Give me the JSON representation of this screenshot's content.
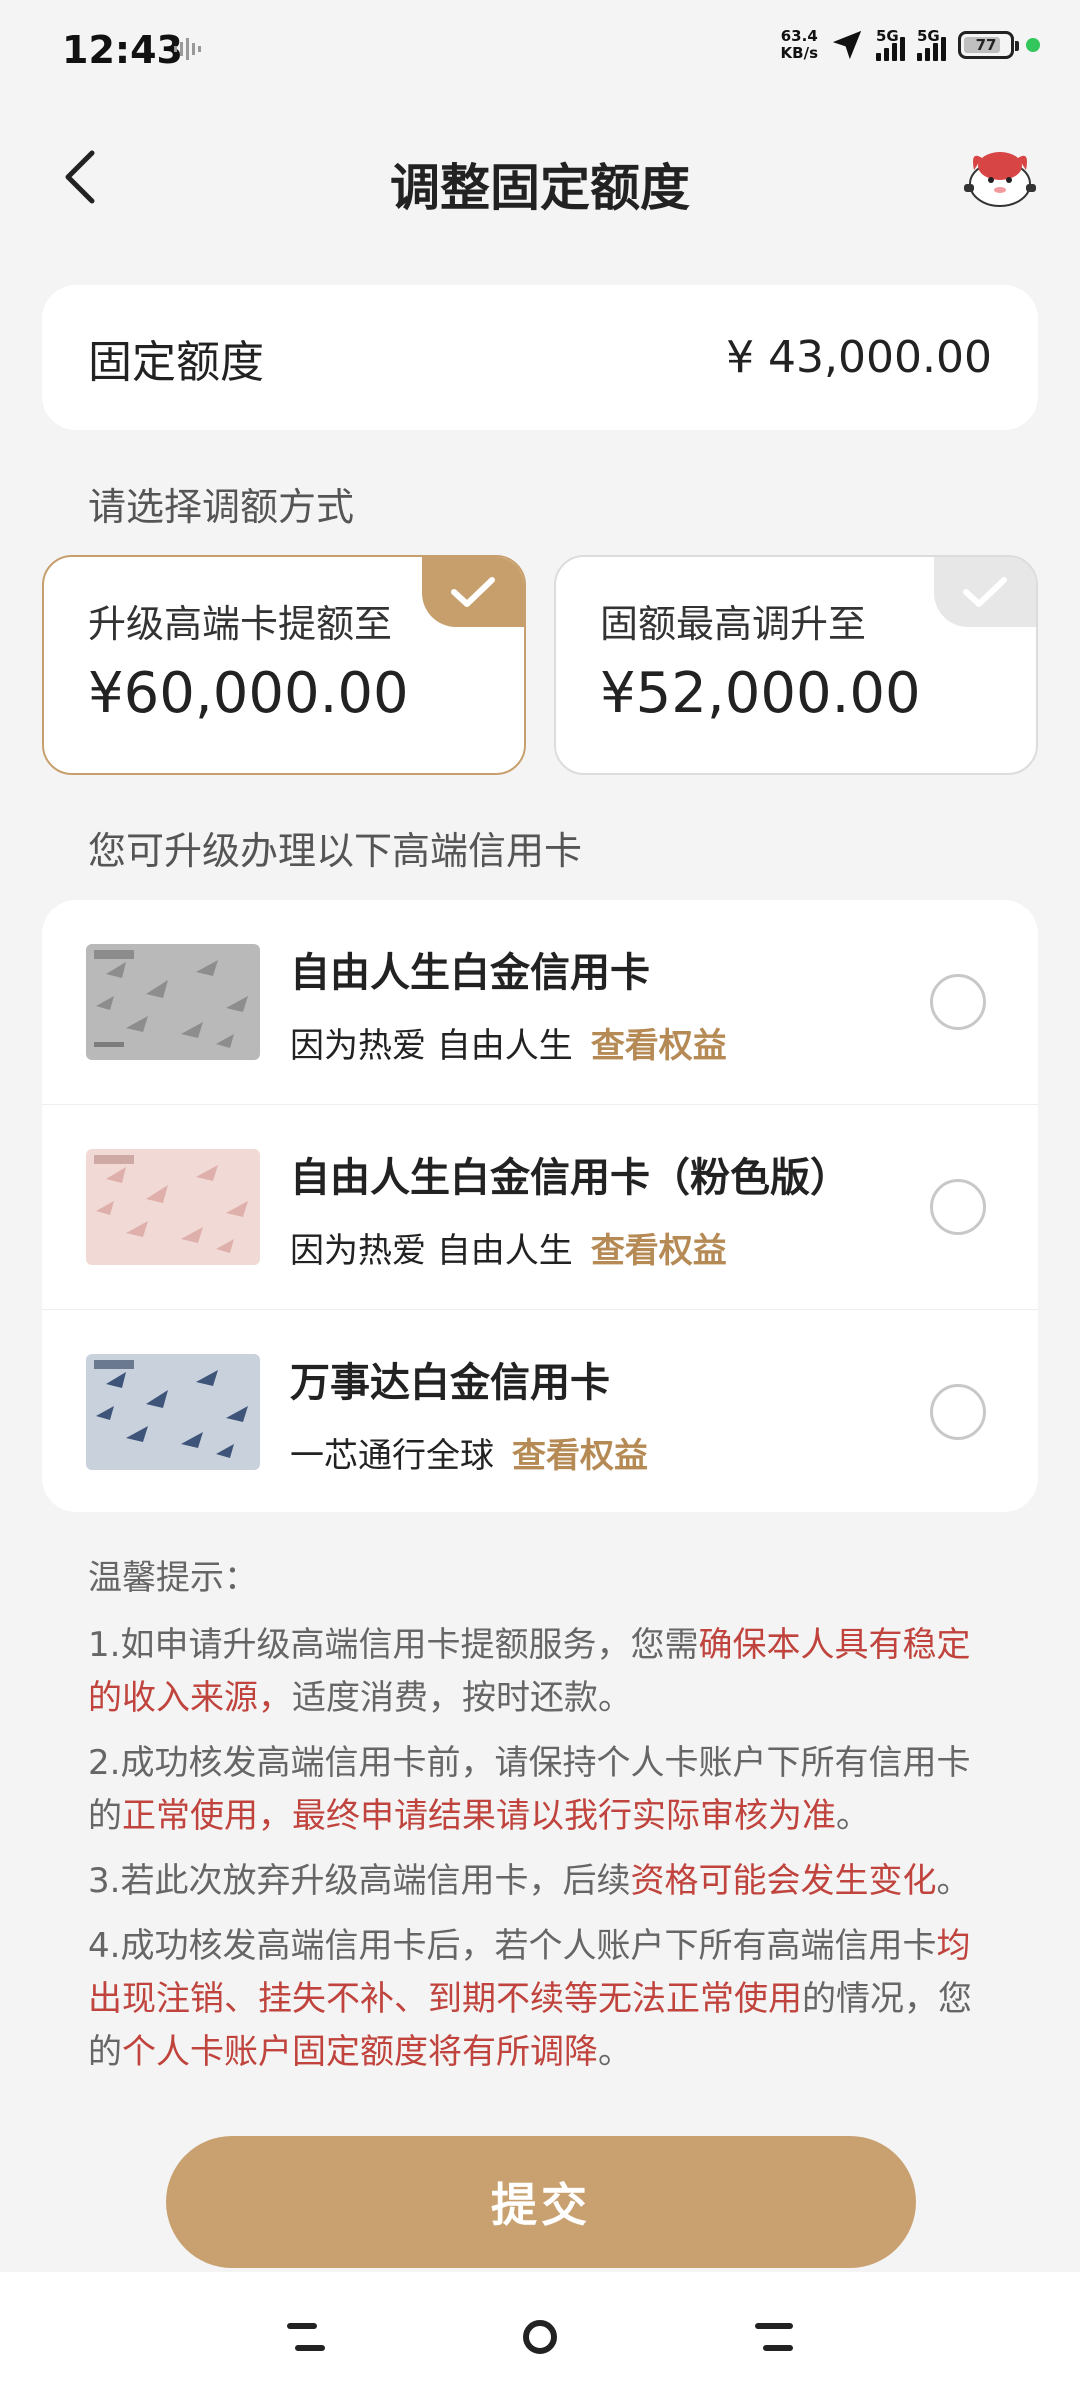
{
  "status_bar": {
    "time": "12:43",
    "net_speed_value": "63.4",
    "net_speed_unit": "KB/s",
    "signal1_label": "5G",
    "signal2_label": "5G",
    "battery": "77"
  },
  "header": {
    "title": "调整固定额度"
  },
  "fixed_limit": {
    "label": "固定额度",
    "value": "¥ 43,000.00"
  },
  "method_section": {
    "label": "请选择调额方式"
  },
  "options": [
    {
      "label": "升级高端卡提额至",
      "value": "¥60,000.00",
      "selected": true
    },
    {
      "label": "固额最高调升至",
      "value": "¥52,000.00",
      "selected": false
    }
  ],
  "cards_section": {
    "label": "您可升级办理以下高端信用卡"
  },
  "cards": [
    {
      "name": "自由人生白金信用卡",
      "slogan": "因为热爱 自由人生",
      "link": "查看权益",
      "checked": false
    },
    {
      "name": "自由人生白金信用卡（粉色版）",
      "slogan": "因为热爱 自由人生",
      "link": "查看权益",
      "checked": false
    },
    {
      "name": "万事达白金信用卡",
      "slogan": "一芯通行全球",
      "link": "查看权益",
      "checked": false
    }
  ],
  "tips": {
    "title": "温馨提示：",
    "t1_a": "1.如申请升级高端信用卡提额服务，您需",
    "t1_b": "确保本人具有稳定的收入来源，",
    "t1_c": "适度消费，按时还款。",
    "t2_a": "2.成功核发高端信用卡前，请保持个人卡账户下所有信用卡的",
    "t2_b": "正常使用，最终申请结果请以我行实际审核为准",
    "t2_c": "。",
    "t3_a": "3.若此次放弃升级高端信用卡，后续",
    "t3_b": "资格可能会发生变化",
    "t3_c": "。",
    "t4_a": "4.成功核发高端信用卡后，若个人账户下所有高端信用卡",
    "t4_b": "均出现注销、挂失不补、到期不续等无法正常使用",
    "t4_c": "的情况，您的",
    "t4_d": "个人卡账户固定额度将有所调降",
    "t4_e": "。"
  },
  "submit": {
    "label": "提交"
  },
  "colors": {
    "accent": "#c9a171",
    "link": "#b58a55",
    "warning": "#c0443d"
  }
}
